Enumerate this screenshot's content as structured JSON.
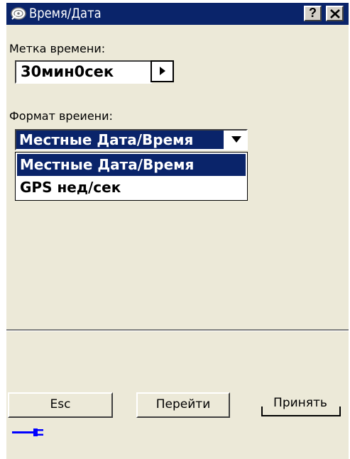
{
  "window": {
    "title": "Время/Дата",
    "help_label": "?",
    "close_icon": "close-icon"
  },
  "timestamp": {
    "label": "Метка времени:",
    "value": "30мин0сек",
    "arrow_icon": "triangle-right-icon"
  },
  "time_format": {
    "label": "Формат вреиени:",
    "selected": "Местные Дата/Время",
    "options": [
      "Местные Дата/Время",
      "GPS нед/сек"
    ],
    "highlighted_index": 0
  },
  "buttons": {
    "esc": "Esc",
    "go": "Перейти",
    "accept": "Принять"
  },
  "status": {
    "power_icon": "plug-icon"
  },
  "colors": {
    "title_bar": "#0a246a",
    "highlight": "#0a246a",
    "background": "#ece9d8"
  }
}
